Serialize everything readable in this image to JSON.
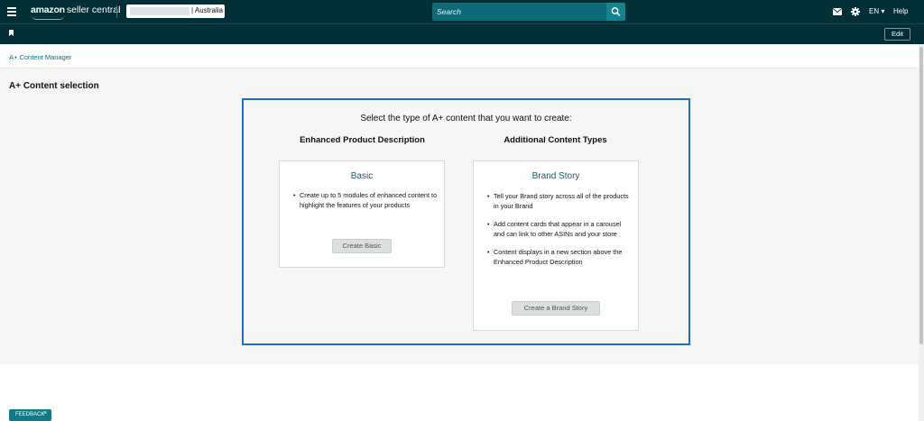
{
  "header": {
    "logo_brand": "amazon",
    "logo_rest": "seller central",
    "account_region": "| Australia",
    "search_placeholder": "Search",
    "language": "EN ▾",
    "help": "Help"
  },
  "subbar": {
    "edit_label": "Edit"
  },
  "breadcrumb": {
    "label": "A+ Content Manager"
  },
  "main": {
    "page_title": "A+ Content selection",
    "prompt": "Select the type of A+ content that you want to create:",
    "columns": [
      {
        "heading": "Enhanced Product Description",
        "card": {
          "title": "Basic",
          "bullets": [
            "Create up to 5 modules of enhanced content to highlight the features of your products"
          ],
          "button": "Create Basic"
        }
      },
      {
        "heading": "Additional Content Types",
        "card": {
          "title": "Brand Story",
          "bullets": [
            "Tell your Brand story across all of the products in your Brand",
            "Add content cards that appear in a carousel and can link to other ASINs and your store",
            "Content displays in a new section above the Enhanced Product Description"
          ],
          "button": "Create a Brand Story"
        }
      }
    ]
  },
  "feedback": {
    "label": "FEEDBACK",
    "close": "×"
  },
  "colors": {
    "header_bg": "#002f36",
    "search_bg": "#0d6b77",
    "accent_link": "#007185",
    "panel_border": "#1f6ec7",
    "page_bg": "#f6f6f6"
  }
}
